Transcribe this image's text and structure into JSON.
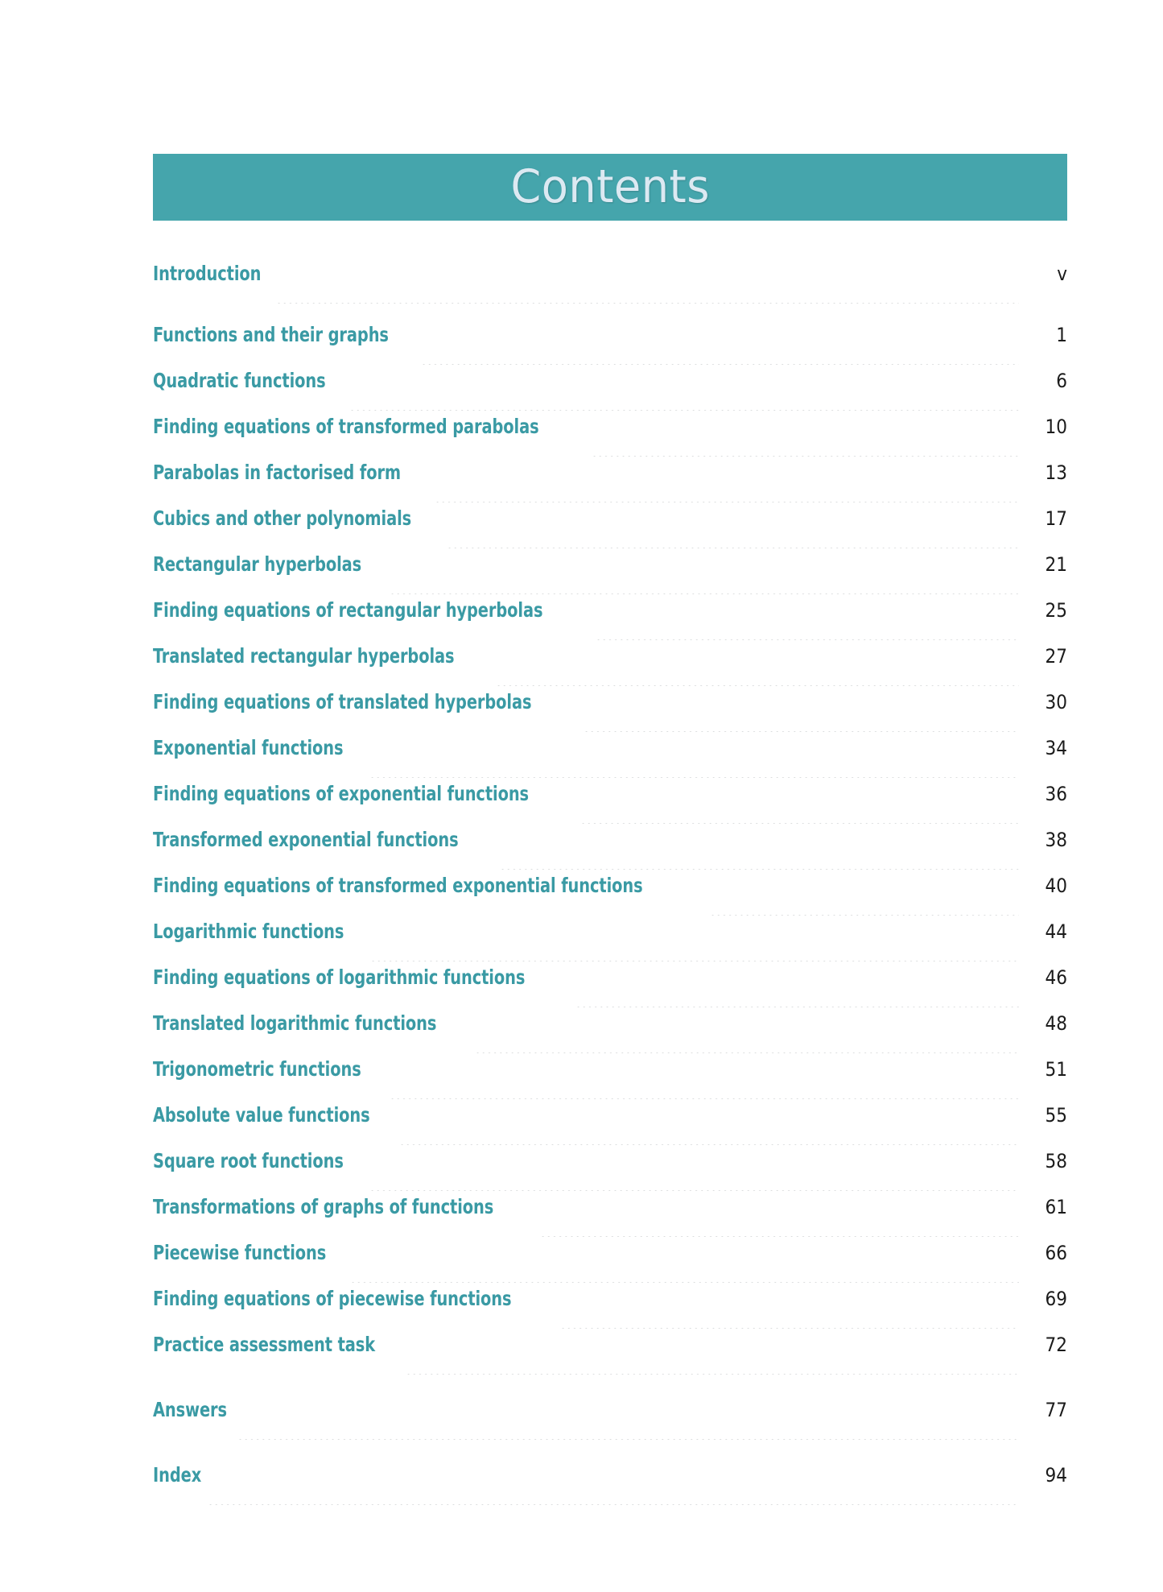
{
  "header": {
    "title": "Contents",
    "banner_color": "#45a5ac",
    "title_color": "#dce9f2"
  },
  "theme": {
    "entry_color": "#3a9aa4",
    "page_number_color": "#1b1b1b",
    "leader_dot_color": "#c9cbcd"
  },
  "toc": {
    "entries": [
      {
        "label": "Introduction",
        "page": "v",
        "spaced_before": false
      },
      {
        "label": "Functions and their graphs",
        "page": "1",
        "spaced_before": false
      },
      {
        "label": "Quadratic functions",
        "page": "6",
        "spaced_before": false
      },
      {
        "label": "Finding equations of transformed parabolas",
        "page": "10",
        "spaced_before": false
      },
      {
        "label": "Parabolas in factorised form",
        "page": "13",
        "spaced_before": false
      },
      {
        "label": "Cubics and other polynomials",
        "page": "17",
        "spaced_before": false
      },
      {
        "label": "Rectangular hyperbolas",
        "page": "21",
        "spaced_before": false
      },
      {
        "label": "Finding equations of rectangular hyperbolas",
        "page": "25",
        "spaced_before": false
      },
      {
        "label": "Translated rectangular hyperbolas",
        "page": "27",
        "spaced_before": false
      },
      {
        "label": "Finding equations of translated hyperbolas",
        "page": "30",
        "spaced_before": false
      },
      {
        "label": "Exponential functions",
        "page": "34",
        "spaced_before": false
      },
      {
        "label": "Finding equations of exponential functions",
        "page": "36",
        "spaced_before": false
      },
      {
        "label": "Transformed exponential functions",
        "page": "38",
        "spaced_before": false
      },
      {
        "label": "Finding equations of transformed exponential functions",
        "page": "40",
        "spaced_before": false
      },
      {
        "label": "Logarithmic functions",
        "page": "44",
        "spaced_before": false
      },
      {
        "label": "Finding equations of logarithmic functions",
        "page": "46",
        "spaced_before": false
      },
      {
        "label": "Translated logarithmic functions",
        "page": "48",
        "spaced_before": false
      },
      {
        "label": "Trigonometric functions",
        "page": "51",
        "spaced_before": false
      },
      {
        "label": "Absolute value functions",
        "page": "55",
        "spaced_before": false
      },
      {
        "label": "Square root functions",
        "page": "58",
        "spaced_before": false
      },
      {
        "label": "Transformations of graphs of functions",
        "page": "61",
        "spaced_before": false
      },
      {
        "label": "Piecewise functions",
        "page": "66",
        "spaced_before": false
      },
      {
        "label": "Finding equations of piecewise functions",
        "page": "69",
        "spaced_before": false
      },
      {
        "label": "Practice assessment task",
        "page": "72",
        "spaced_before": false
      },
      {
        "label": "Answers",
        "page": "77",
        "spaced_before": true
      },
      {
        "label": "Index",
        "page": "94",
        "spaced_before": true
      }
    ]
  }
}
